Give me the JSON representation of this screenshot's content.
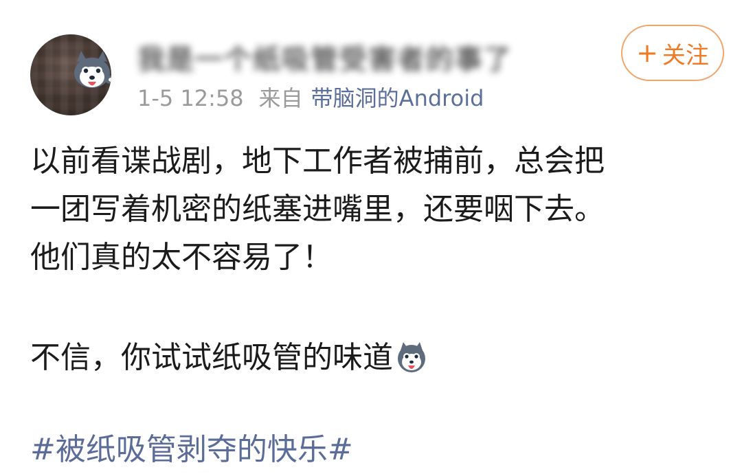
{
  "author": {
    "name": "我是一个纸吸管受害者的事了",
    "time": "1-5 12:58",
    "from_label": "来自",
    "source": "带脑洞的Android"
  },
  "follow_button": {
    "plus": "+",
    "label": "关注"
  },
  "post": {
    "lines": [
      "以前看谍战剧，地下工作者被捕前，总会把",
      "一团写着机密的纸塞进嘴里，还要咽下去。",
      "他们真的太不容易了！"
    ],
    "para2": "不信，你试试纸吸管的味道",
    "emoji": "husky-emoji",
    "hashtag": "#被纸吸管剥夺的快乐#"
  },
  "colors": {
    "follow": "#f07a24",
    "link": "#5a6c97",
    "meta": "#9a9a9a"
  }
}
